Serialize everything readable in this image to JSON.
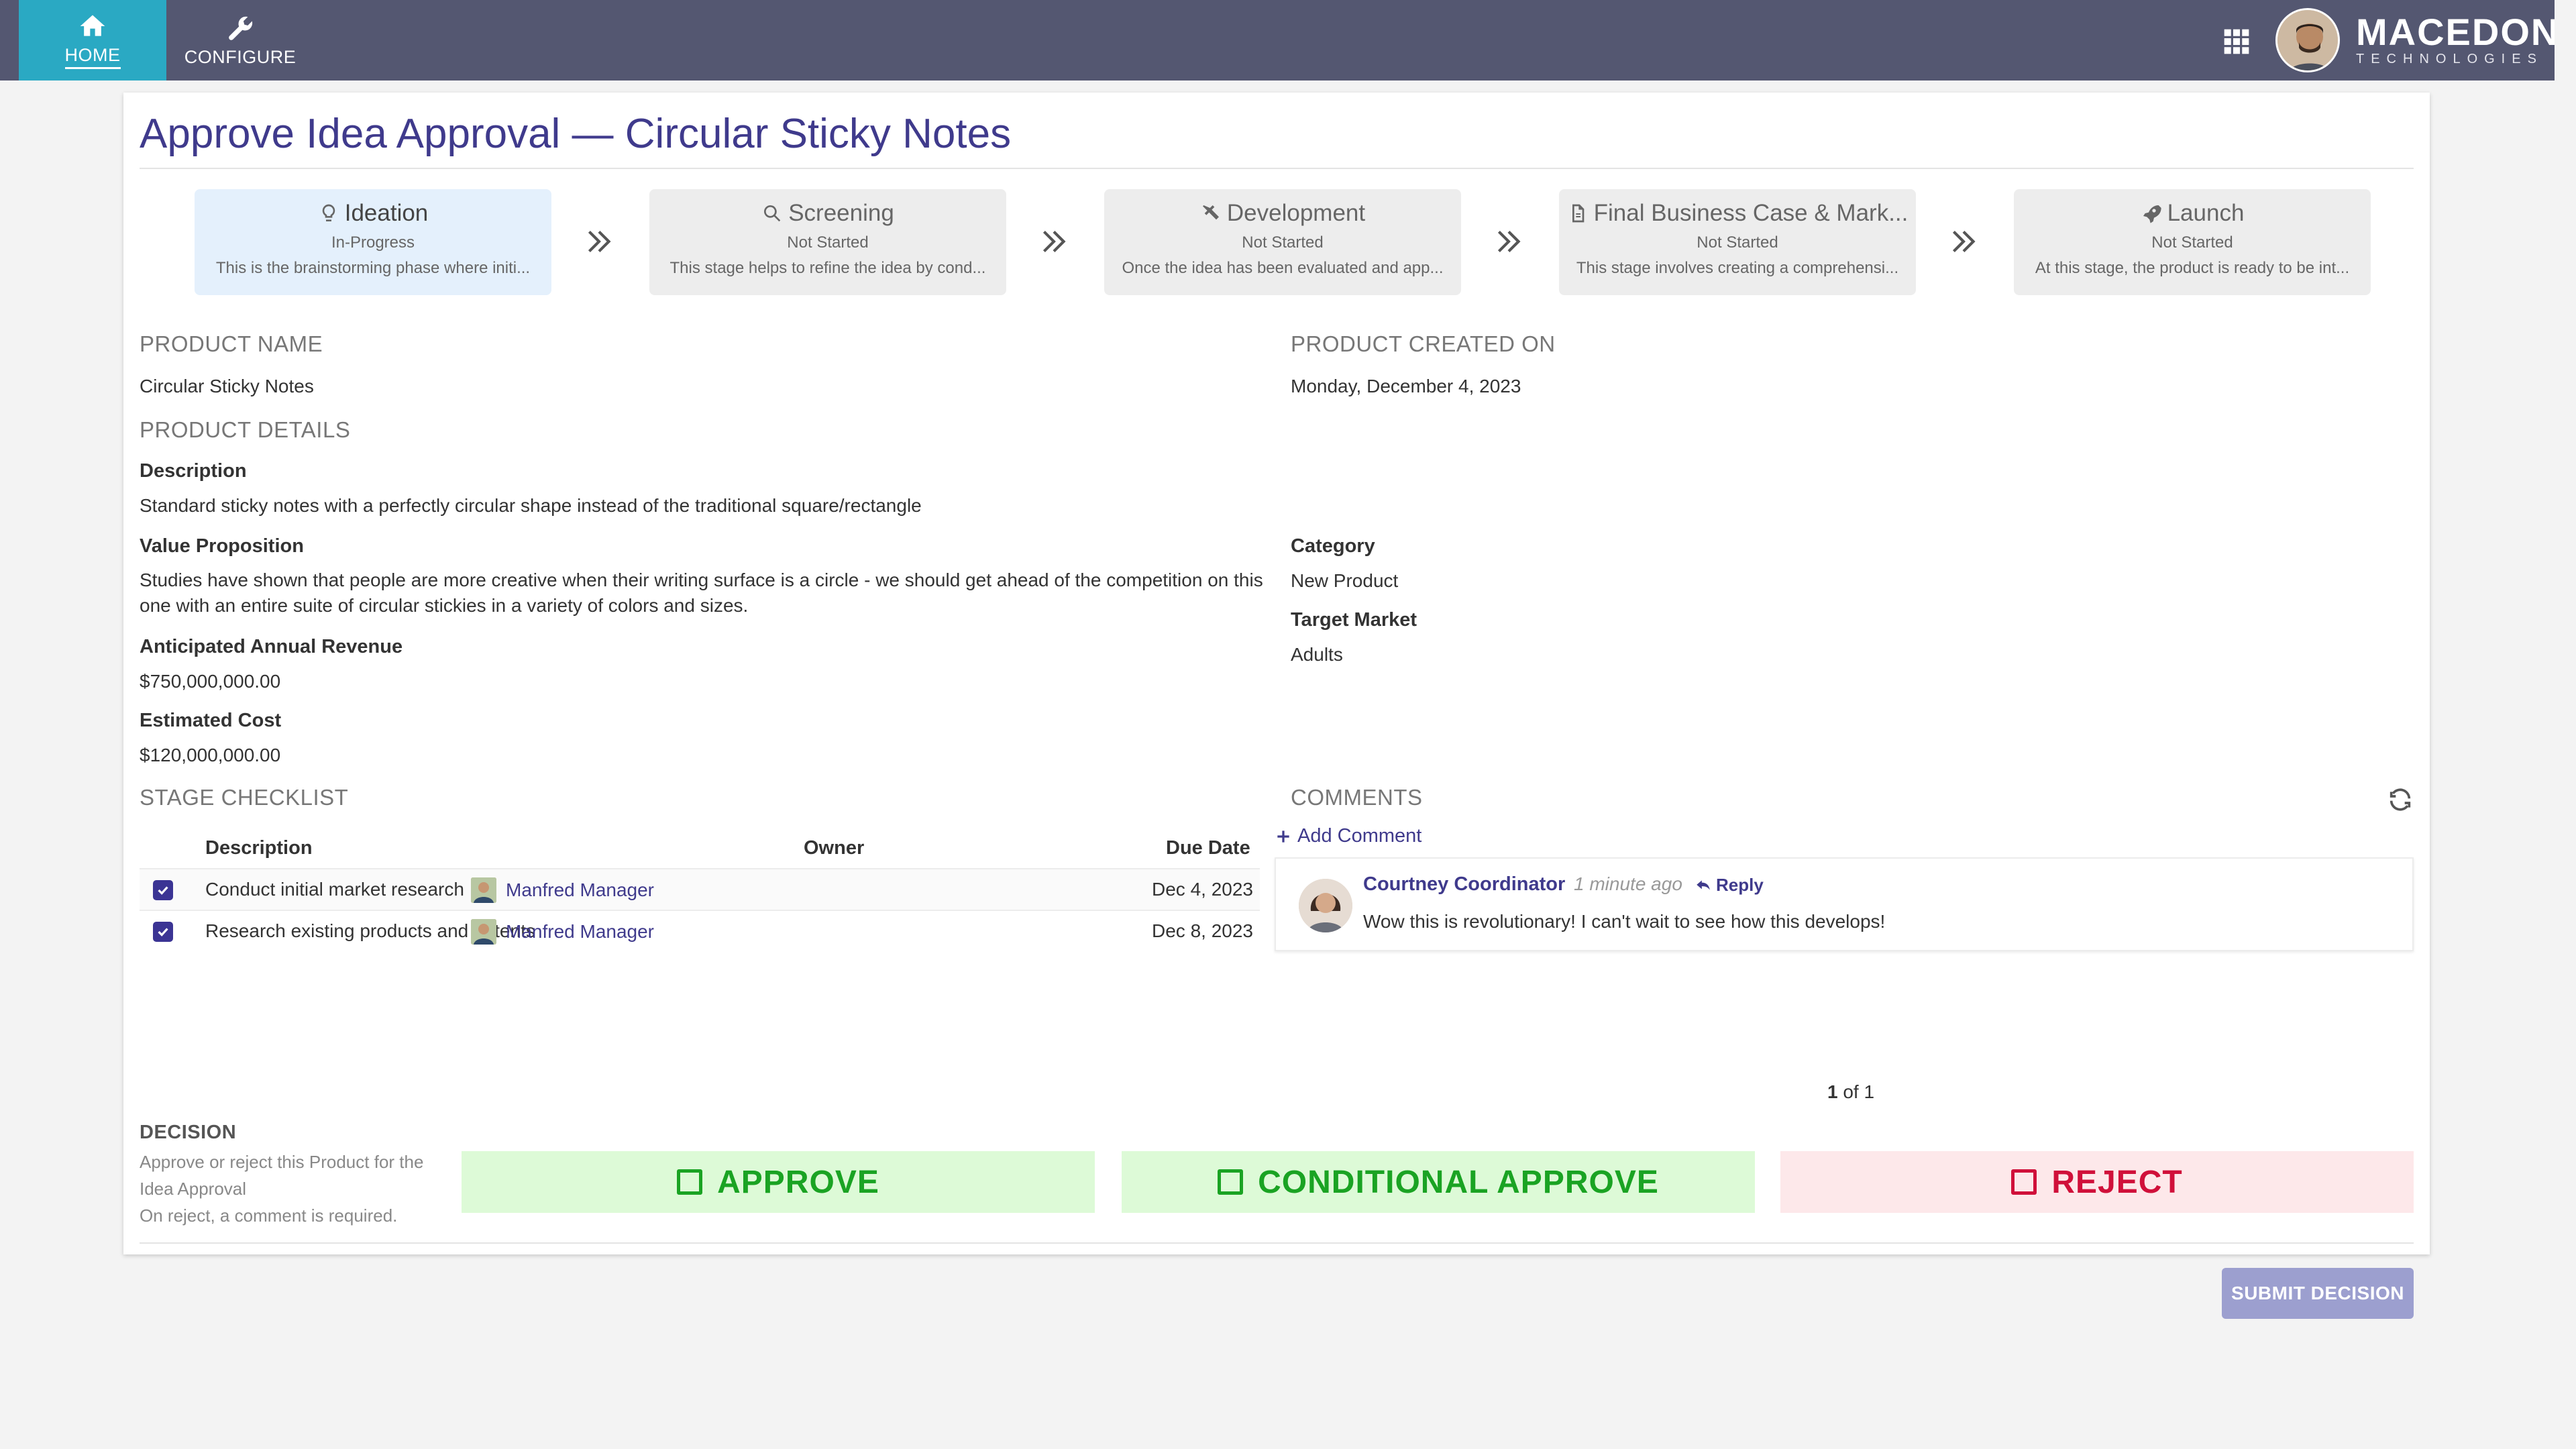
{
  "nav": {
    "home_label": "HOME",
    "configure_label": "CONFIGURE"
  },
  "brand": {
    "name": "MACEDON",
    "sub": "TECHNOLOGIES"
  },
  "page": {
    "title": "Approve Idea Approval — Circular Sticky Notes"
  },
  "stages": [
    {
      "name": "Ideation",
      "icon": "lightbulb-icon",
      "status": "In-Progress",
      "desc": "This is the brainstorming phase where initi...",
      "active": true
    },
    {
      "name": "Screening",
      "icon": "search-icon",
      "status": "Not Started",
      "desc": "This stage helps to refine the idea by cond...",
      "active": false
    },
    {
      "name": "Development",
      "icon": "tools-icon",
      "status": "Not Started",
      "desc": "Once the idea has been evaluated and app...",
      "active": false
    },
    {
      "name": "Final Business Case & Mark...",
      "icon": "document-icon",
      "status": "Not Started",
      "desc": "This stage involves creating a comprehensi...",
      "active": false
    },
    {
      "name": "Launch",
      "icon": "rocket-icon",
      "status": "Not Started",
      "desc": "At this stage, the product is ready to be int...",
      "active": false
    }
  ],
  "product": {
    "name_label": "PRODUCT NAME",
    "name": "Circular Sticky Notes",
    "created_label": "PRODUCT CREATED ON",
    "created": "Monday, December 4, 2023",
    "details_label": "PRODUCT DETAILS",
    "description_label": "Description",
    "description": "Standard sticky notes with a perfectly circular shape instead of the traditional square/rectangle",
    "value_prop_label": "Value Proposition",
    "value_prop": "Studies have shown that people are more creative when their writing surface is a circle - we should get ahead of the competition on this one with an entire suite of circular stickies in a variety of colors and sizes.",
    "revenue_label": "Anticipated Annual Revenue",
    "revenue": "$750,000,000.00",
    "cost_label": "Estimated Cost",
    "cost": "$120,000,000.00",
    "category_label": "Category",
    "category": "New Product",
    "market_label": "Target Market",
    "market": "Adults"
  },
  "checklist": {
    "label": "STAGE CHECKLIST",
    "headers": {
      "description": "Description",
      "owner": "Owner",
      "due": "Due Date"
    },
    "rows": [
      {
        "description": "Conduct initial market research",
        "owner": "Manfred Manager",
        "due": "Dec 4, 2023",
        "checked": true
      },
      {
        "description": "Research existing products and patents",
        "owner": "Manfred Manager",
        "due": "Dec 8, 2023",
        "checked": true
      }
    ]
  },
  "comments": {
    "label": "COMMENTS",
    "add_label": "Add Comment",
    "items": [
      {
        "author": "Courtney Coordinator",
        "time": "1 minute ago",
        "reply_label": "Reply",
        "text": "Wow this is revolutionary! I can't wait to see how this develops!"
      }
    ],
    "pager_current": "1",
    "pager_rest": " of 1"
  },
  "decision": {
    "label": "DECISION",
    "help1": "Approve or reject this Product for the Idea Approval",
    "help2": "On reject, a comment is required.",
    "approve": "APPROVE",
    "conditional": "CONDITIONAL APPROVE",
    "reject": "REJECT",
    "submit": "SUBMIT DECISION"
  },
  "colors": {
    "topbar": "#545771",
    "home_active": "#2aa9c3",
    "title": "#3f3a8c",
    "approve": "#1aa323",
    "reject": "#d0103a"
  }
}
